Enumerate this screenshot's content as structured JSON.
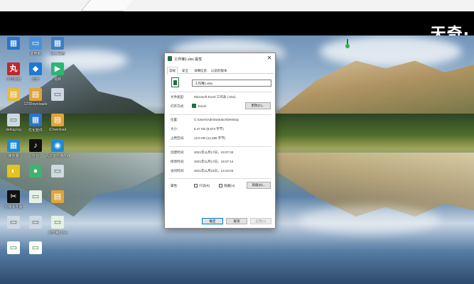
{
  "watermark": "天奇·",
  "desktop_icons": [
    {
      "label": "",
      "glyph": "▦",
      "color": "#2a73c8"
    },
    {
      "label": "此电脑",
      "glyph": "▭",
      "color": "#4a90d9"
    },
    {
      "label": "网上邻居",
      "glyph": "▦",
      "color": "#3d7fc1"
    },
    {
      "label": "小区规划",
      "glyph": "丸",
      "color": "#c0282d"
    },
    {
      "label": "迅雷",
      "glyph": "◆",
      "color": "#1f78d1"
    },
    {
      "label": "视频",
      "glyph": "▶",
      "color": "#2bb673"
    },
    {
      "label": "",
      "glyph": "▤",
      "color": "#e8b93c"
    },
    {
      "label": "123Downloads",
      "glyph": "▤",
      "color": "#e0a43a"
    },
    {
      "label": "",
      "glyph": "▭",
      "color": "#cfd8e3"
    },
    {
      "label": "debug.log",
      "glyph": "▭",
      "color": "#cfd8e3"
    },
    {
      "label": "优化软件",
      "glyph": "▦",
      "color": "#2a73c8"
    },
    {
      "label": "cDownload",
      "glyph": "▤",
      "color": "#e0a43a"
    },
    {
      "label": "播放器",
      "glyph": "▦",
      "color": "#1e8ad6"
    },
    {
      "label": "抖音",
      "glyph": "♪",
      "color": "#111111"
    },
    {
      "label": "风云音乐播放器",
      "glyph": "◉",
      "color": "#1e8ad6"
    },
    {
      "label": "",
      "glyph": "◐",
      "color": "#e4c21f"
    },
    {
      "label": "",
      "glyph": "●",
      "color": "#3cb371"
    },
    {
      "label": "",
      "glyph": "▭",
      "color": "#cfd8e3"
    },
    {
      "label": "剪映专业版",
      "glyph": "✂",
      "color": "#111111"
    },
    {
      "label": "",
      "glyph": "▭",
      "color": "#e6f1e6"
    },
    {
      "label": "",
      "glyph": "▤",
      "color": "#e0a43a"
    },
    {
      "label": "",
      "glyph": "▭",
      "color": "#cfd8e3"
    },
    {
      "label": "",
      "glyph": "▭",
      "color": "#cfd8e3"
    },
    {
      "label": "工作簿1.xlsx",
      "glyph": "▭",
      "color": "#e6f1e6"
    },
    {
      "label": "",
      "glyph": "▭",
      "color": "#ffffff"
    },
    {
      "label": "",
      "glyph": "▭",
      "color": "#ffffff"
    }
  ],
  "dialog": {
    "title": "工作簿1.xlsx 属性",
    "close": "✕",
    "tabs": [
      "常规",
      "安全",
      "详细信息",
      "以前的版本"
    ],
    "file_name": "工作簿1.xlsx",
    "rows": {
      "type_label": "文件类型:",
      "type_value": "Microsoft Excel 工作表 (.xlsx)",
      "opens_label": "打开方式:",
      "opens_value": "Excel",
      "change_btn": "更改(C)...",
      "location_label": "位置:",
      "location_value": "C:\\Users\\Administrator\\Desktop",
      "size_label": "大小:",
      "size_value": "8.47 KB (8,674 字节)",
      "disk_label": "占用空间:",
      "disk_value": "12.0 KB (12,288 字节)",
      "created_label": "创建时间:",
      "created_value": "2021年11月17日，15:07:33",
      "modified_label": "修改时间:",
      "modified_value": "2021年11月17日，15:07:14",
      "accessed_label": "访问时间:",
      "accessed_value": "2021年11月24日，14:22:03",
      "attr_label": "属性:",
      "readonly_label": "只读(R)",
      "hidden_label": "隐藏(H)",
      "advanced_btn": "高级(D)..."
    },
    "buttons": {
      "ok": "确定",
      "cancel": "取消",
      "apply": "应用(A)"
    }
  }
}
